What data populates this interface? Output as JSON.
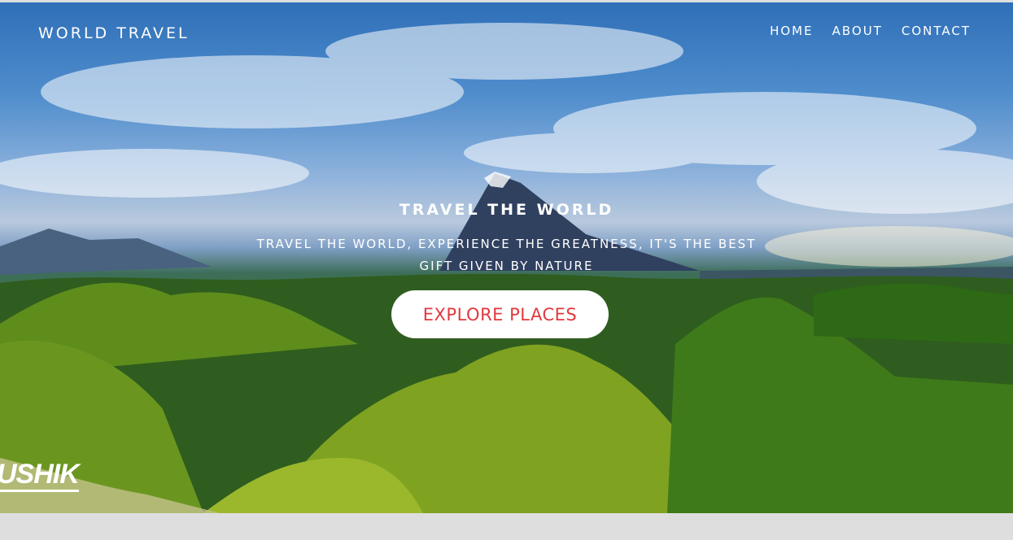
{
  "header": {
    "brand": "WORLD TRAVEL",
    "nav": [
      {
        "label": "HOME"
      },
      {
        "label": "ABOUT"
      },
      {
        "label": "CONTACT"
      }
    ]
  },
  "hero": {
    "headline": "TRAVEL THE WORLD",
    "tagline": "TRAVEL THE WORLD, EXPERIENCE THE GREATNESS, IT'S THE BEST GIFT GIVEN BY NATURE",
    "cta_label": "EXPLORE PLACES",
    "signature": "USHIK"
  },
  "colors": {
    "cta_text": "#e0393e",
    "cta_background": "#ffffff",
    "text": "#ffffff",
    "page_background": "#dedede"
  }
}
